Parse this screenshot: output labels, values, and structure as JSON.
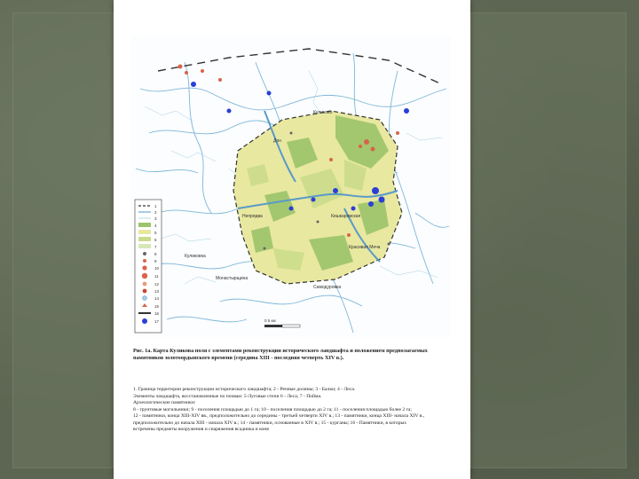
{
  "slide": {
    "caption": "Рис. 1а. Карта Куликова поля с элементами реконструкции исторического ландшафта и положением предполагаемых памятников золотоордынского времени (середина XIII - последняя четверть XIV в.).",
    "legend_lines": [
      "1. Граница территории реконструкции исторического ландшафта; 2 - Речные долины; 3 - Балки; 4 - Леса.",
      "Элементы ландшафта, восстановленные по почвам: 5-Луговые степи 6 - Леса; 7 - Пойма.",
      "Археологические памятники:",
      "8 - грунтовые могильники; 9 - поселения площадью до 1 га; 10 - поселения площадью до 2 га; 11 - поселения площадью более 2 га;",
      "12 - памятники, конца XIII-XIV вв., предположительно до середины - третьей четверти XIV в.; 13 - памятники, конца XIII- начала XIV в.,",
      "предположительно до начала XIII - начала XIV в.; 14 - памятники, основанные в XIV в.; 15 - курганы; 16 - Памятники, в которых",
      "встречены предметы вооружения и снаряжения всадника и коня"
    ]
  },
  "map": {
    "place_labels": [
      "Куликово",
      "Монастырщина",
      "Непрядва",
      "Дон",
      "Красивая Меча",
      "Самодуровка",
      "Кишкаревская",
      "Куликовка"
    ],
    "scale_label": "0 5 км",
    "legend_numbers": [
      "1",
      "2",
      "3",
      "4",
      "5",
      "6",
      "7",
      "8",
      "9",
      "10",
      "11",
      "12",
      "13",
      "14",
      "15",
      "16",
      "17"
    ],
    "colors": {
      "steppe": "#e8e8a0",
      "forest": "#9cc46a",
      "meadow": "#c9dc8a",
      "river": "#7fb6d8",
      "site_blue": "#2a3fd6",
      "site_red": "#d8644a",
      "boundary": "#333333"
    }
  }
}
